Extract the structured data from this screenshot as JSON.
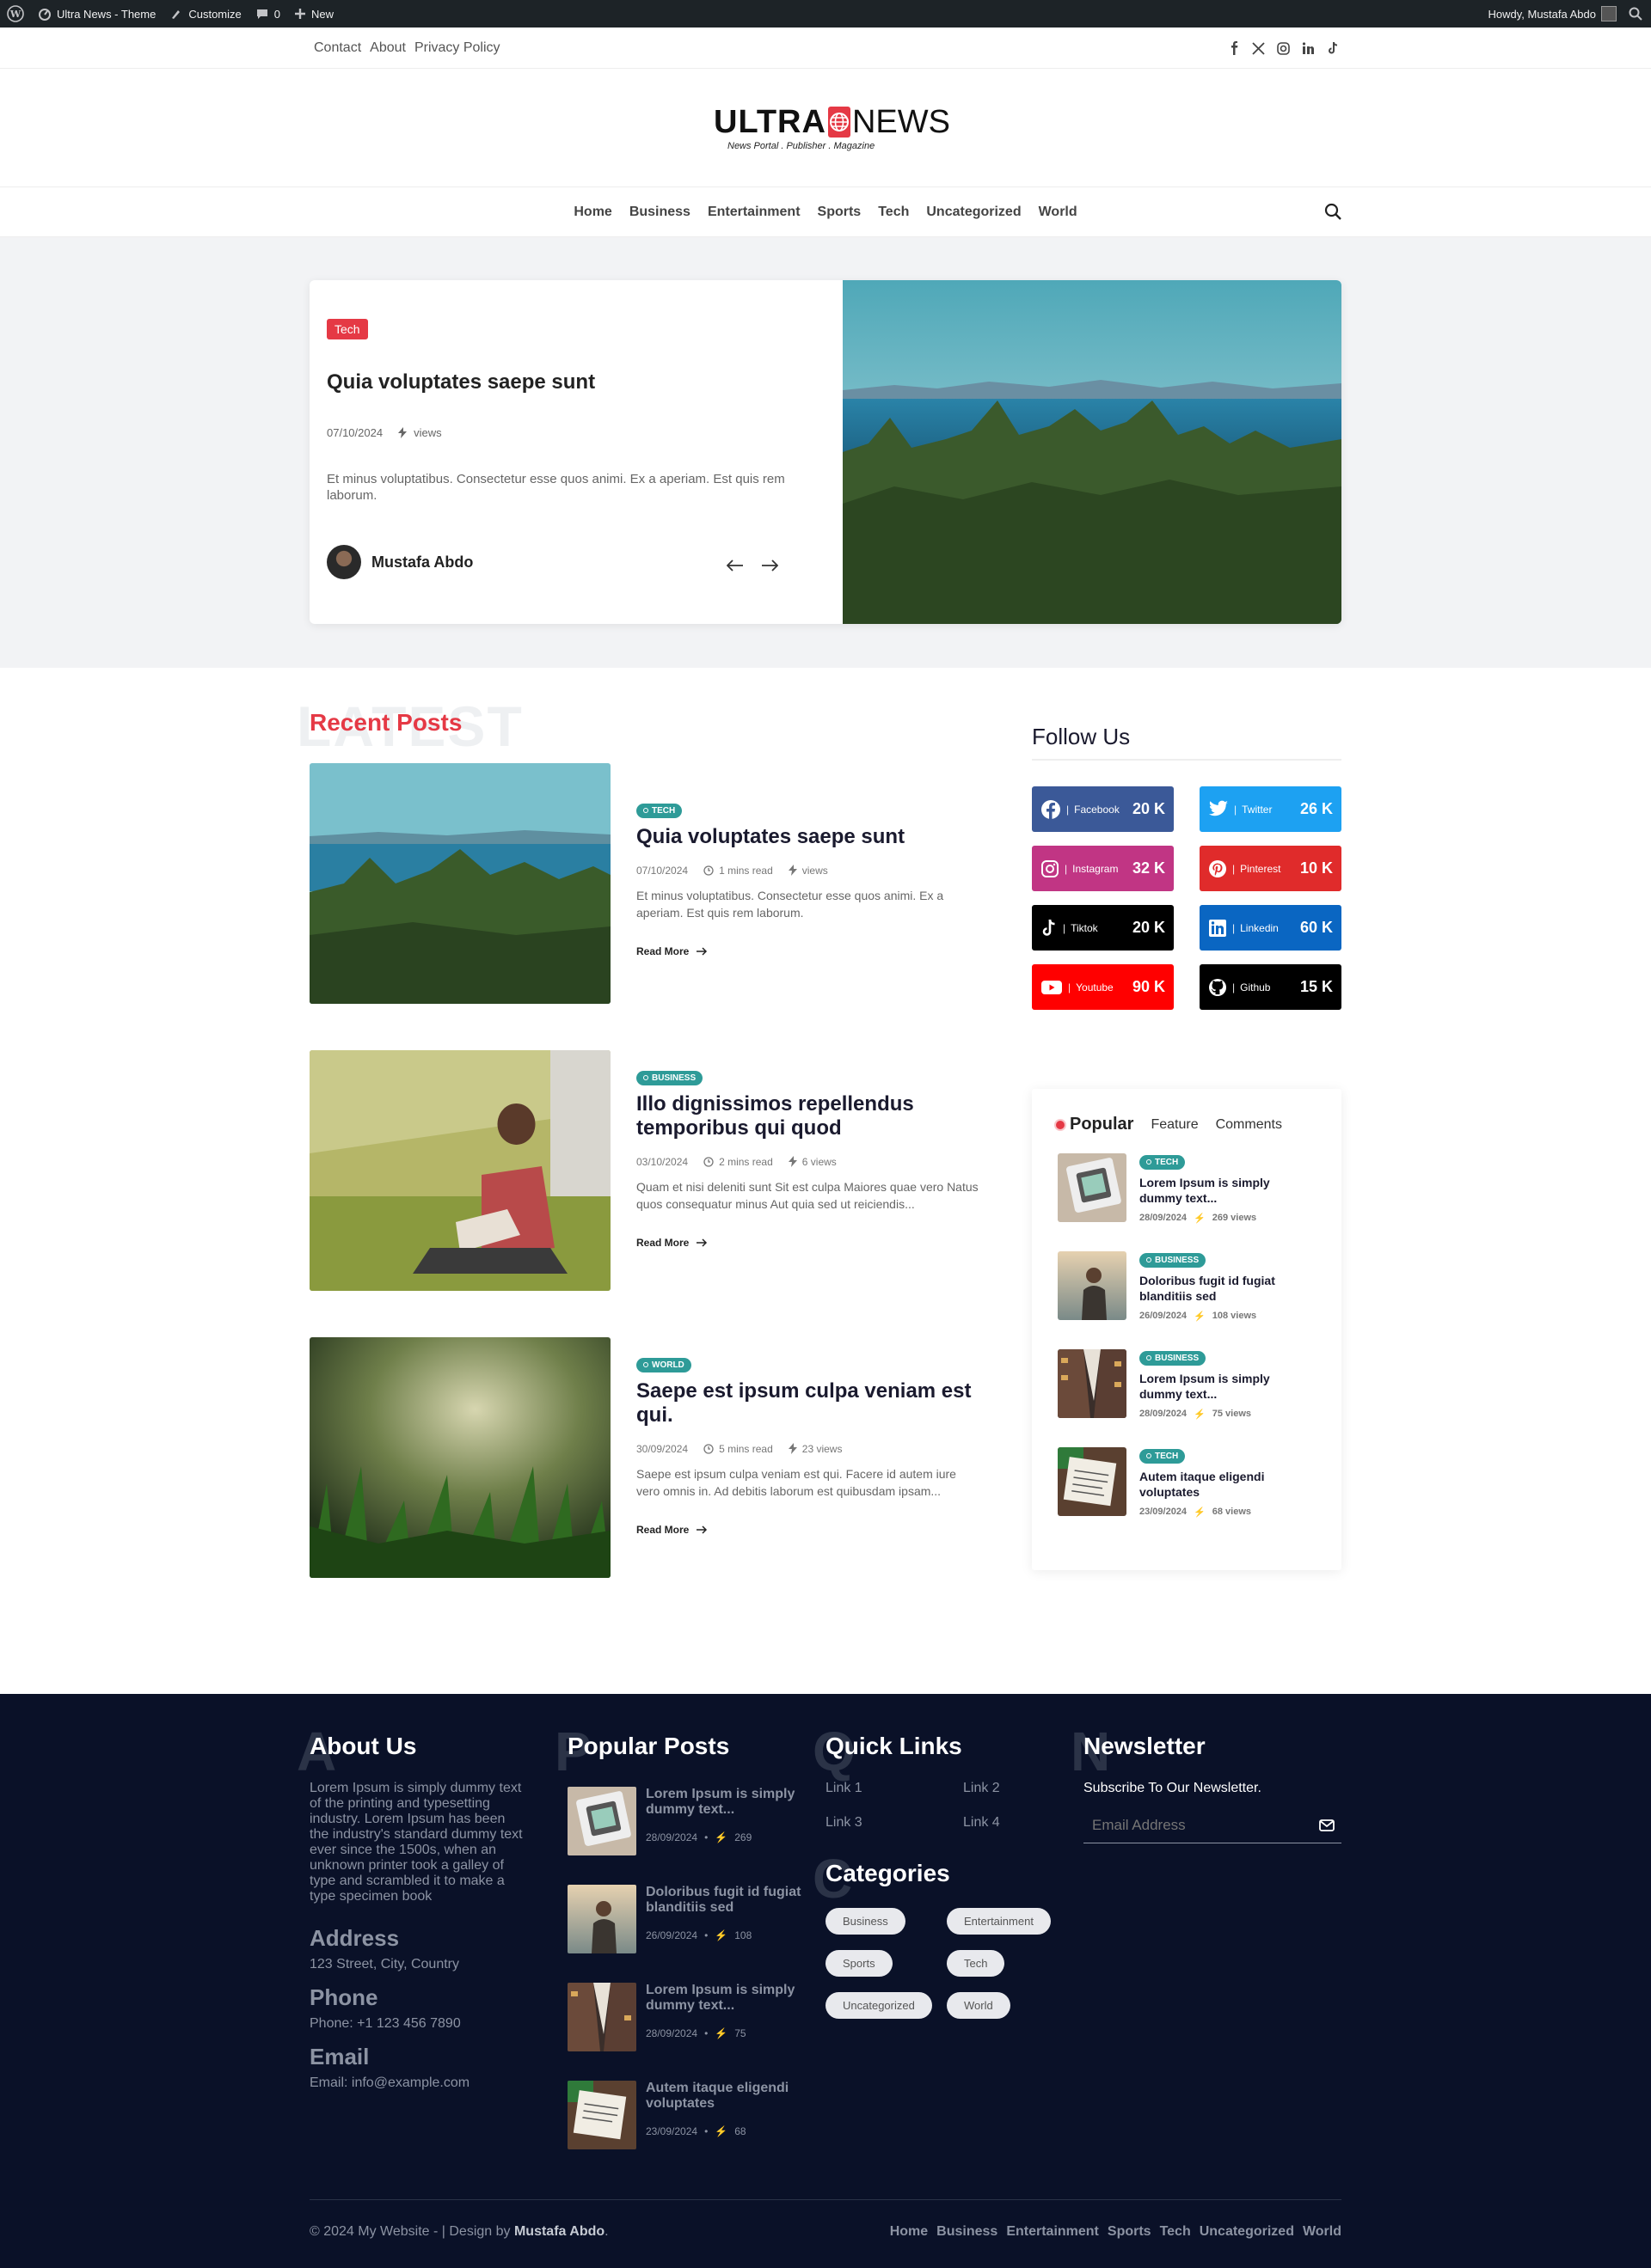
{
  "adminbar": {
    "site": "Ultra News - Theme",
    "customize": "Customize",
    "comments": "0",
    "new": "New",
    "howdy": "Howdy, Mustafa Abdo"
  },
  "topbar": {
    "links": [
      "Contact",
      "About",
      "Privacy Policy"
    ]
  },
  "logo": {
    "ultra": "ULTRA",
    "news": "NEWS",
    "tagline": "News Portal . Publisher . Magazine"
  },
  "nav": {
    "items": [
      "Home",
      "Business",
      "Entertainment",
      "Sports",
      "Tech",
      "Uncategorized",
      "World"
    ]
  },
  "hero": {
    "badge": "Tech",
    "title": "Quia voluptates saepe sunt",
    "date": "07/10/2024",
    "views": "views",
    "excerpt": "Et minus voluptatibus. Consectetur esse quos animi. Ex a aperiam. Est quis rem laborum.",
    "author": "Mustafa Abdo"
  },
  "recent": {
    "bigword": "LATEST",
    "heading": "Recent Posts",
    "read_more": "Read More",
    "posts": [
      {
        "tag": "TECH",
        "title": "Quia voluptates saepe sunt",
        "date": "07/10/2024",
        "read": "1 mins read",
        "views": "views",
        "excerpt": "Et minus voluptatibus. Consectetur esse quos animi. Ex a aperiam. Est quis rem laborum."
      },
      {
        "tag": "BUSINESS",
        "title": "Illo dignissimos repellendus temporibus qui quod",
        "date": "03/10/2024",
        "read": "2 mins read",
        "views": "6 views",
        "excerpt": "Quam et nisi deleniti sunt Sit est culpa Maiores quae vero Natus quos consequatur minus Aut quia sed ut reiciendis..."
      },
      {
        "tag": "WORLD",
        "title": "Saepe est ipsum culpa veniam est qui.",
        "date": "30/09/2024",
        "read": "5 mins read",
        "views": "23 views",
        "excerpt": "Saepe est ipsum culpa veniam est qui. Facere id autem iure vero omnis in. Ad debitis laborum est quibusdam ipsam..."
      }
    ]
  },
  "follow": {
    "title": "Follow Us",
    "items": [
      {
        "name": "Facebook",
        "count": "20 K",
        "color": "#3b5998"
      },
      {
        "name": "Twitter",
        "count": "26 K",
        "color": "#1da1f2"
      },
      {
        "name": "Instagram",
        "count": "32 K",
        "color": "#c13584"
      },
      {
        "name": "Pinterest",
        "count": "10 K",
        "color": "#e02b2b"
      },
      {
        "name": "Tiktok",
        "count": "20 K",
        "color": "#000000"
      },
      {
        "name": "Linkedin",
        "count": "60 K",
        "color": "#0a66c2"
      },
      {
        "name": "Youtube",
        "count": "90 K",
        "color": "#ff0000"
      },
      {
        "name": "Github",
        "count": "15 K",
        "color": "#000000"
      }
    ]
  },
  "popular": {
    "tabs": [
      "Popular",
      "Feature",
      "Comments"
    ],
    "items": [
      {
        "tag": "TECH",
        "title": "Lorem Ipsum is simply dummy text...",
        "date": "28/09/2024",
        "views": "269 views"
      },
      {
        "tag": "BUSINESS",
        "title": "Doloribus fugit id fugiat blanditiis sed",
        "date": "26/09/2024",
        "views": "108 views"
      },
      {
        "tag": "BUSINESS",
        "title": "Lorem Ipsum is simply dummy text...",
        "date": "28/09/2024",
        "views": "75 views"
      },
      {
        "tag": "TECH",
        "title": "Autem itaque eligendi voluptates",
        "date": "23/09/2024",
        "views": "68 views"
      }
    ]
  },
  "footer": {
    "about": {
      "letter": "A",
      "title": "About Us",
      "text": "Lorem Ipsum is simply dummy text of the printing and typesetting industry. Lorem Ipsum has been the industry's standard dummy text ever since the 1500s, when an unknown printer took a galley of type and scrambled it to make a type specimen book",
      "address_label": "Address",
      "address": "123 Street, City, Country",
      "phone_label": "Phone",
      "phone": "Phone: +1 123 456 7890",
      "email_label": "Email",
      "email": "Email: info@example.com"
    },
    "popular": {
      "letter": "P",
      "title": "Popular Posts",
      "items": [
        {
          "title": "Lorem Ipsum is simply dummy text...",
          "date": "28/09/2024",
          "views": "269"
        },
        {
          "title": "Doloribus fugit id fugiat blanditiis sed",
          "date": "26/09/2024",
          "views": "108"
        },
        {
          "title": "Lorem Ipsum is simply dummy text...",
          "date": "28/09/2024",
          "views": "75"
        },
        {
          "title": "Autem itaque eligendi voluptates",
          "date": "23/09/2024",
          "views": "68"
        }
      ]
    },
    "quick": {
      "letter": "Q",
      "title": "Quick Links",
      "links": [
        "Link 1",
        "Link 2",
        "Link 3",
        "Link 4"
      ]
    },
    "categories": {
      "letter": "C",
      "title": "Categories",
      "items": [
        "Business",
        "Entertainment",
        "Sports",
        "Tech",
        "Uncategorized",
        "World"
      ]
    },
    "newsletter": {
      "letter": "N",
      "title": "Newsletter",
      "subtitle": "Subscribe To Our Newsletter.",
      "placeholder": "Email Address"
    },
    "copyright_pre": "© 2024 My Website - | Design by ",
    "copyright_author": "Mustafa Abdo",
    "copyright_post": ".",
    "nav": [
      "Home",
      "Business",
      "Entertainment",
      "Sports",
      "Tech",
      "Uncategorized",
      "World"
    ]
  }
}
